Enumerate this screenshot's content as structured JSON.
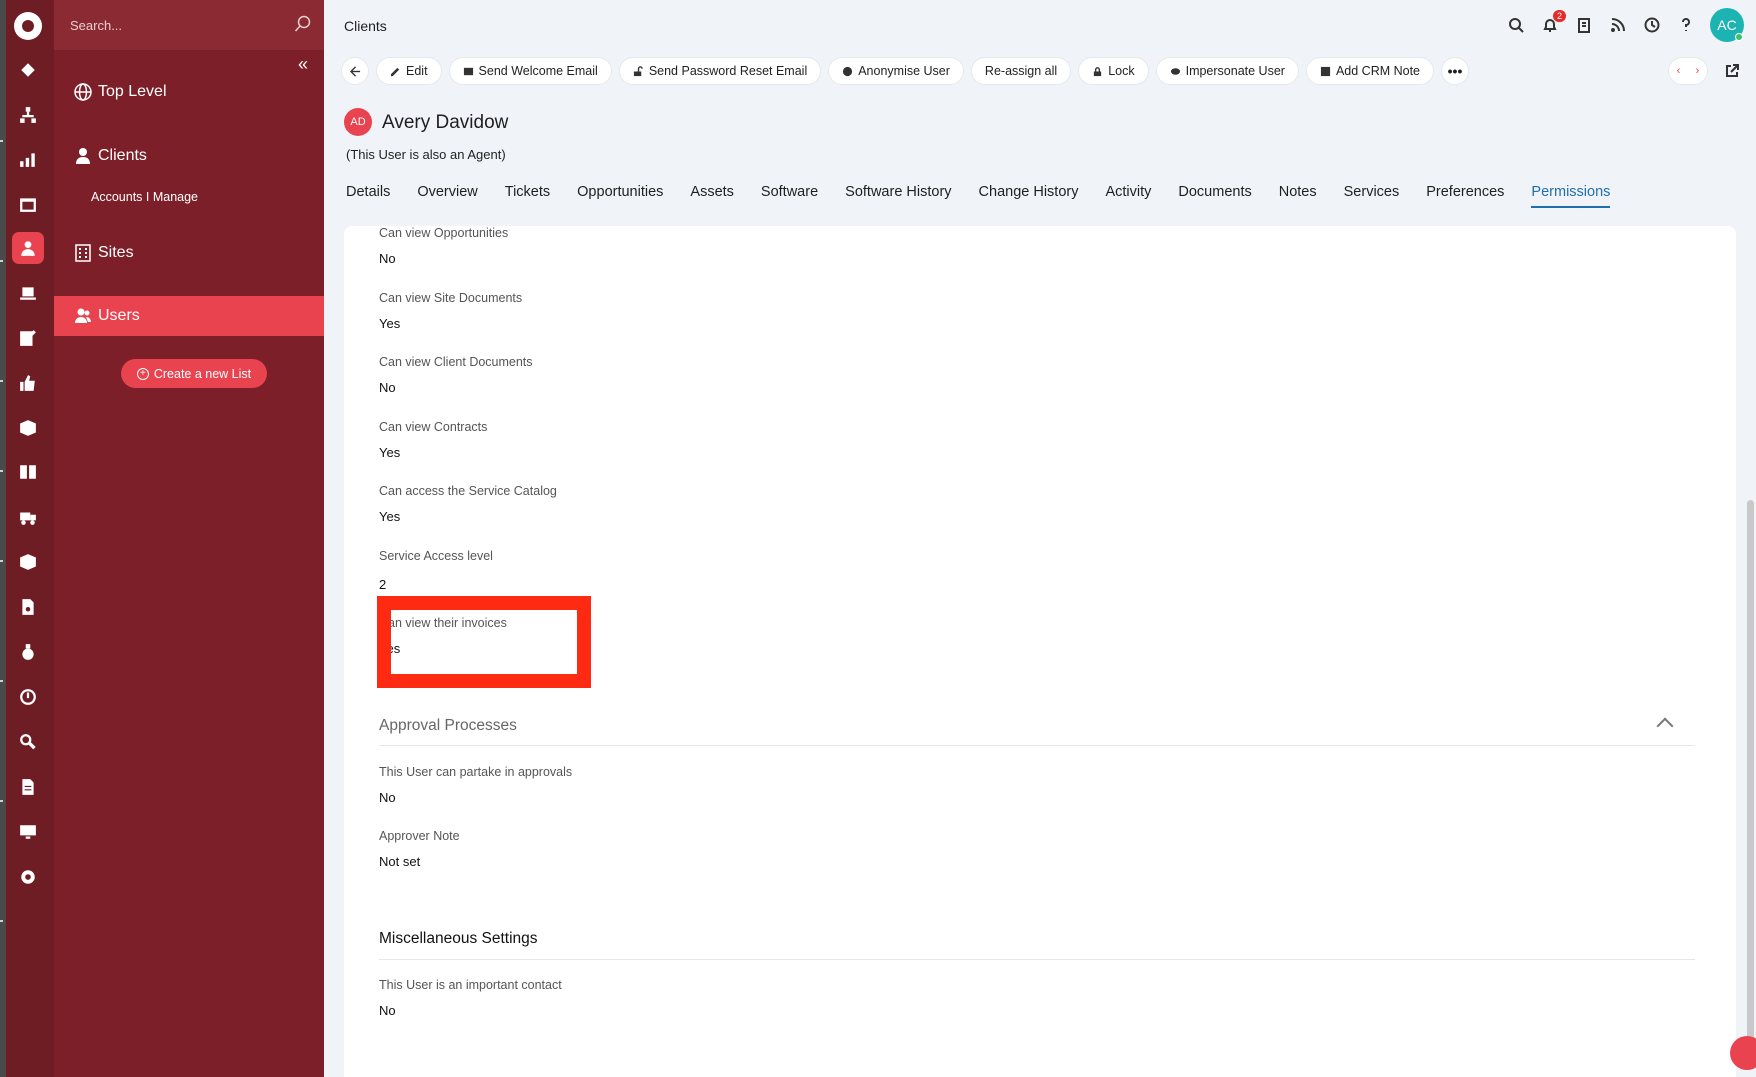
{
  "search": {
    "placeholder": "Search..."
  },
  "nav": {
    "items": [
      {
        "label": "Top Level",
        "icon": "globe-icon"
      },
      {
        "label": "Clients",
        "icon": "user-icon"
      },
      {
        "label": "Sites",
        "icon": "building-icon"
      },
      {
        "label": "Users",
        "icon": "users-icon"
      }
    ],
    "sub_item": "Accounts I Manage",
    "create_button": "Create a new List"
  },
  "header": {
    "title": "Clients",
    "notification_count": "2",
    "user_initials": "AC"
  },
  "toolbar": {
    "edit": "Edit",
    "send_welcome": "Send Welcome Email",
    "send_reset": "Send Password Reset Email",
    "anonymise": "Anonymise User",
    "reassign": "Re-assign all",
    "lock": "Lock",
    "impersonate": "Impersonate User",
    "add_crm": "Add CRM Note"
  },
  "user": {
    "initials": "AD",
    "name": "Avery Davidow",
    "note": "(This User is also an Agent)"
  },
  "tabs": [
    "Details",
    "Overview",
    "Tickets",
    "Opportunities",
    "Assets",
    "Software",
    "Software History",
    "Change History",
    "Activity",
    "Documents",
    "Notes",
    "Services",
    "Preferences",
    "Permissions"
  ],
  "active_tab": "Permissions",
  "permissions": [
    {
      "label": "Can view Opportunities",
      "value": "No"
    },
    {
      "label": "Can view Site Documents",
      "value": "Yes"
    },
    {
      "label": "Can view Client Documents",
      "value": "No"
    },
    {
      "label": "Can view Contracts",
      "value": "Yes"
    },
    {
      "label": "Can access the Service Catalog",
      "value": "Yes"
    },
    {
      "label": "Service Access level",
      "value": "2"
    },
    {
      "label": "Can view their invoices",
      "value": "Yes"
    }
  ],
  "approval": {
    "title": "Approval Processes",
    "fields": [
      {
        "label": "This User can partake in approvals",
        "value": "No"
      },
      {
        "label": "Approver Note",
        "value": "Not set"
      }
    ]
  },
  "misc": {
    "title": "Miscellaneous Settings",
    "fields": [
      {
        "label": "This User is an important contact",
        "value": "No"
      }
    ]
  },
  "colors": {
    "sidebar": "#7c1f28",
    "accent": "#e8434f",
    "link": "#1f6fb0",
    "highlight": "#ff2a12"
  }
}
